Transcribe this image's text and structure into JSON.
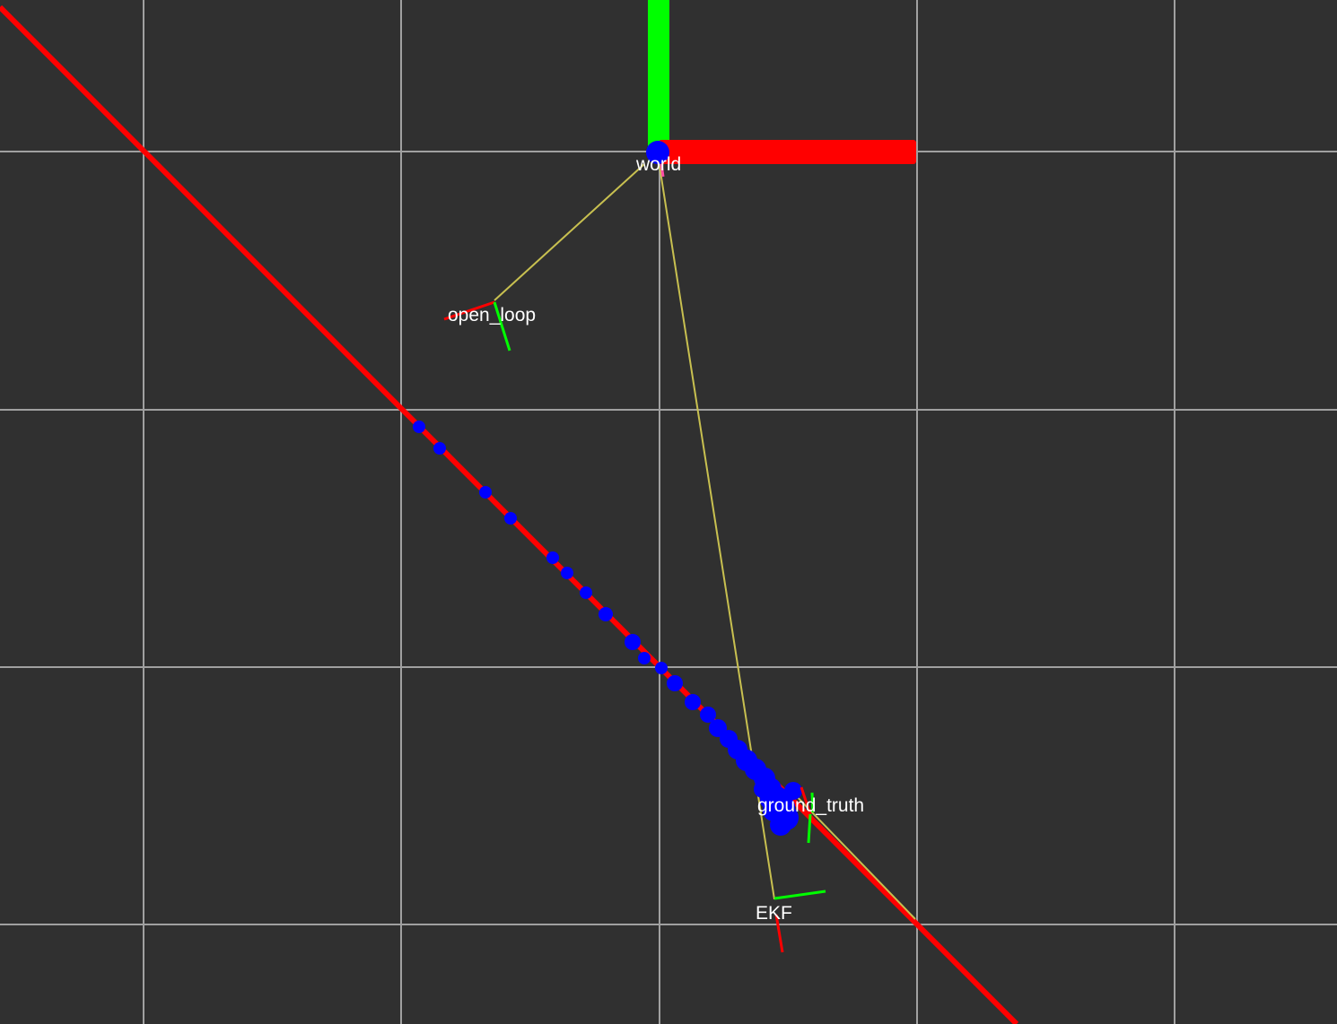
{
  "scene": {
    "background_color": "#303030",
    "grid_color": "#a0a0a0",
    "axis_colors": {
      "x": "#ff0000",
      "y": "#00ff00",
      "z": "#0000ff"
    },
    "tf_link_color": "#c8c050",
    "path_color": "#ff0000",
    "marker_color": "#0000ff"
  },
  "frames": {
    "world": {
      "label": "world"
    },
    "open_loop": {
      "label": "open_loop"
    },
    "ground_truth": {
      "label": "ground_truth"
    },
    "ekf": {
      "label": "EKF"
    }
  }
}
